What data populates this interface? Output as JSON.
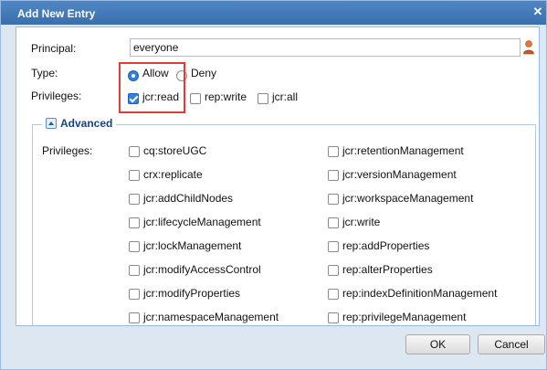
{
  "dialog": {
    "title": "Add New Entry",
    "close_icon": "close-icon"
  },
  "form": {
    "principal_label": "Principal:",
    "principal_value": "everyone",
    "type_label": "Type:",
    "type_options": [
      "Allow",
      "Deny"
    ],
    "type_selected": "Allow",
    "privileges_label": "Privileges:",
    "basic_privileges": [
      {
        "label": "jcr:read",
        "checked": true
      },
      {
        "label": "rep:write",
        "checked": false
      },
      {
        "label": "jcr:all",
        "checked": false
      }
    ]
  },
  "advanced": {
    "legend": "Advanced",
    "privileges_label": "Privileges:",
    "left_column": [
      "cq:storeUGC",
      "crx:replicate",
      "jcr:addChildNodes",
      "jcr:lifecycleManagement",
      "jcr:lockManagement",
      "jcr:modifyAccessControl",
      "jcr:modifyProperties",
      "jcr:namespaceManagement"
    ],
    "right_column": [
      "jcr:retentionManagement",
      "jcr:versionManagement",
      "jcr:workspaceManagement",
      "jcr:write",
      "rep:addProperties",
      "rep:alterProperties",
      "rep:indexDefinitionManagement",
      "rep:privilegeManagement"
    ]
  },
  "buttons": {
    "ok": "OK",
    "cancel": "Cancel"
  },
  "colors": {
    "title_bar": "#3f78b8",
    "accent": "#2f7fe5",
    "highlight": "#e23b3b"
  }
}
